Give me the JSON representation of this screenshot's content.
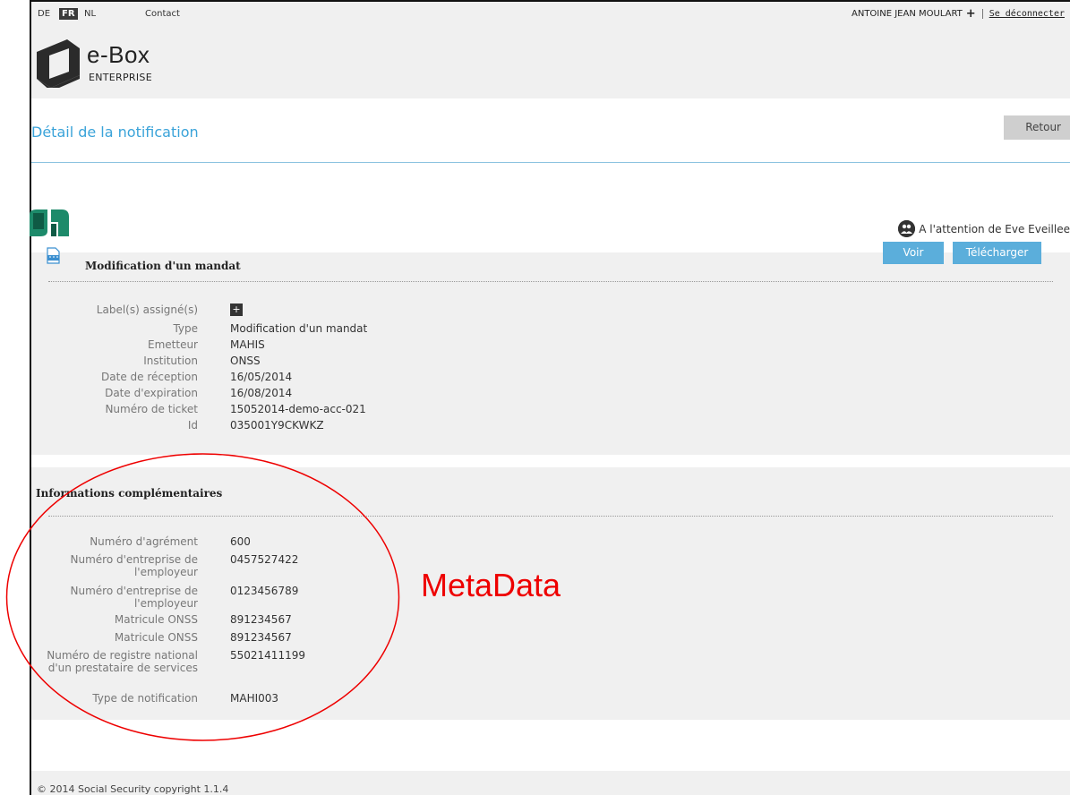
{
  "header": {
    "languages": [
      {
        "label": "DE",
        "active": false
      },
      {
        "label": "FR",
        "active": true
      },
      {
        "label": "NL",
        "active": false
      }
    ],
    "contact_label": "Contact",
    "user_name": "ANTOINE JEAN MOULART",
    "user_plus": "+",
    "logout_label": "Se déconnecter",
    "logo_title": "e-Box",
    "logo_subtitle": "ENTERPRISE"
  },
  "page": {
    "title": "Détail de la notification",
    "back_button": "Retour",
    "attention": "A l'attention de Eve Eveillee"
  },
  "notification": {
    "title": "Modification d'un mandat",
    "view_button": "Voir",
    "download_button": "Télécharger",
    "labels_assigned": "Label(s) assigné(s)",
    "add_label_glyph": "+",
    "fields": [
      {
        "label": "Type",
        "value": "Modification d'un mandat"
      },
      {
        "label": "Emetteur",
        "value": "MAHIS"
      },
      {
        "label": "Institution",
        "value": "ONSS"
      },
      {
        "label": "Date de réception",
        "value": "16/05/2014"
      },
      {
        "label": "Date d'expiration",
        "value": "16/08/2014"
      },
      {
        "label": "Numéro de ticket",
        "value": "15052014-demo-acc-021"
      },
      {
        "label": "Id",
        "value": "035001Y9CKWKZ"
      }
    ]
  },
  "additional_info": {
    "title": "Informations complémentaires",
    "fields": [
      {
        "label": "Numéro d'agrément",
        "value": "600"
      },
      {
        "label": "Numéro d'entreprise de l'employeur",
        "value": "0457527422"
      },
      {
        "label": "Numéro d'entreprise de l'employeur",
        "value": "0123456789"
      },
      {
        "label": "Matricule ONSS",
        "value": "891234567"
      },
      {
        "label": "Matricule ONSS",
        "value": "891234567"
      },
      {
        "label": "Numéro de registre national d'un prestataire de services",
        "value": "55021411199"
      },
      {
        "label": "Type de notification",
        "value": "MAHI003"
      }
    ]
  },
  "annotation": {
    "text": "MetaData",
    "color": "#ee0000"
  },
  "footer": {
    "copyright": "© 2014 Social Security copyright  1.1.4"
  },
  "colors": {
    "accent": "#3aa3d9",
    "button_blue": "#5baedb",
    "panel_bg": "#f0f0f0"
  },
  "icons": {
    "logo": "ebox-logo-icon",
    "institution": "ehealth-logo-icon",
    "attention": "person-icon",
    "document": "pdf-icon"
  }
}
